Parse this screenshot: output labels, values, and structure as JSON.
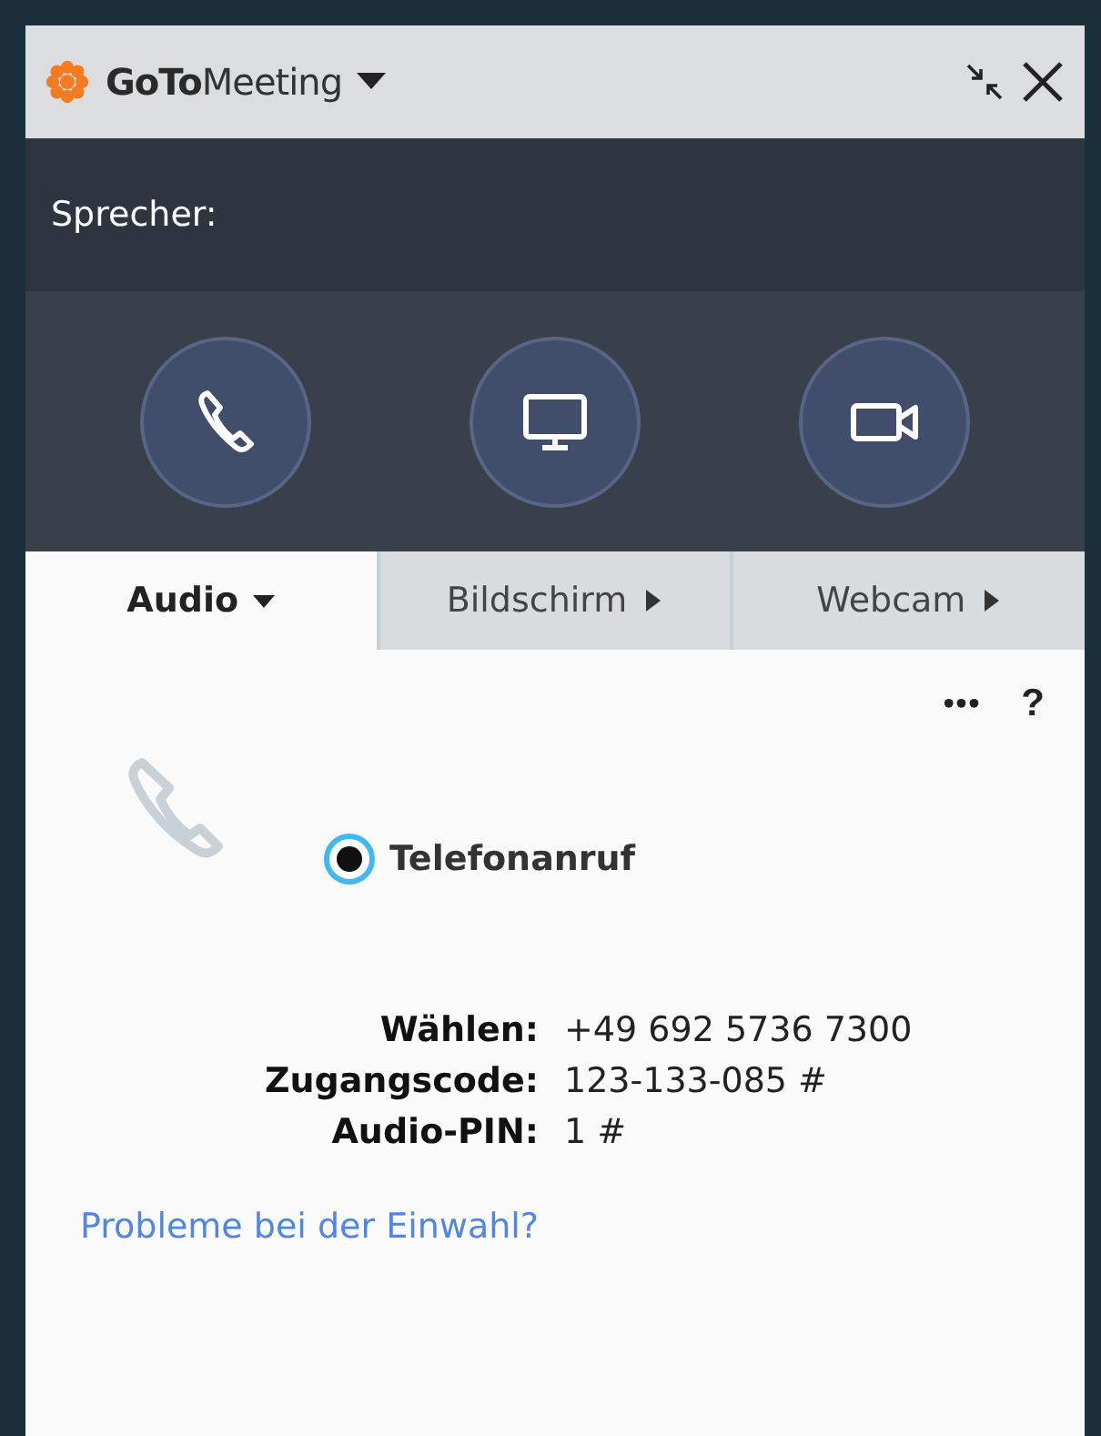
{
  "title_bar": {
    "app_name": "**GoTo**Meeting"
  },
  "speaker": {
    "label": "Sprecher:"
  },
  "action_buttons": [
    {
      "kind": "phone"
    },
    {
      "kind": "screen"
    },
    {
      "kind": "camera"
    }
  ],
  "tabs": [
    {
      "label": "Audio",
      "selected": true
    },
    {
      "label": "Bildschirm",
      "selected": false
    },
    {
      "label": "Webcam",
      "selected": false
    }
  ],
  "toolbar": {
    "more": "•••",
    "help": "?"
  },
  "audio_options": [
    {
      "label": "Telefonanruf",
      "selected": true
    }
  ],
  "dial_info": [
    {
      "label": "Wählen:",
      "value": "+49 692 5736 7300"
    },
    {
      "label": "Zugangscode:",
      "value": "123-133-085 #"
    },
    {
      "label": "Audio-PIN:",
      "value": "1 #"
    }
  ],
  "help_link": "Probleme bei der Einwahl?"
}
